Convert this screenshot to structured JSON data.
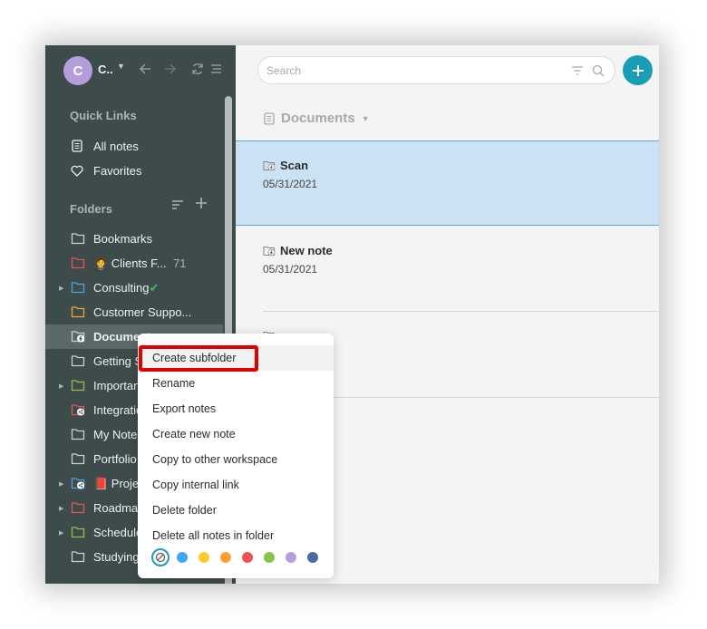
{
  "workspace": {
    "initial": "C",
    "name": "C..",
    "avatar_color": "#b39ddb"
  },
  "toolbar_icons": [
    "chevron-down-icon",
    "back-arrow-icon",
    "forward-arrow-icon",
    "sync-icon",
    "menu-icon"
  ],
  "quick_links": {
    "title": "Quick Links",
    "items": [
      {
        "label": "All notes",
        "icon": "note-icon"
      },
      {
        "label": "Favorites",
        "icon": "heart-icon"
      }
    ]
  },
  "folders": {
    "title": "Folders",
    "items": [
      {
        "label": "Bookmarks",
        "color": "#c8d0d0",
        "expandable": false
      },
      {
        "label": "Clients F...",
        "emoji": "🤵",
        "count": "71",
        "color": "#e8515a",
        "expandable": false
      },
      {
        "label": "Consulting",
        "suffix": "✔",
        "color": "#4aa3e8",
        "expandable": true
      },
      {
        "label": "Customer Suppo...",
        "color": "#f2a33a",
        "expandable": false
      },
      {
        "label": "Documents",
        "color": "#c8d0d0",
        "expandable": false,
        "active": true,
        "badge": "lightning"
      },
      {
        "label": "Getting Started",
        "color": "#c8d0d0",
        "expandable": false
      },
      {
        "label": "Important",
        "color": "#8bc34a",
        "expandable": true
      },
      {
        "label": "Integrations",
        "color": "#e8515a",
        "expandable": false,
        "badge": "share"
      },
      {
        "label": "My Notes",
        "color": "#c8d0d0",
        "expandable": false
      },
      {
        "label": "Portfolio",
        "color": "#c8d0d0",
        "expandable": false
      },
      {
        "label": "Projects",
        "emoji": "📕",
        "color": "#4aa3e8",
        "expandable": true,
        "badge": "share"
      },
      {
        "label": "Roadmap",
        "color": "#e8515a",
        "expandable": true
      },
      {
        "label": "Schedule",
        "color": "#8bc34a",
        "expandable": true
      },
      {
        "label": "Studying",
        "color": "#c8d0d0",
        "expandable": false
      }
    ]
  },
  "search": {
    "placeholder": "Search",
    "value": ""
  },
  "list": {
    "title": "Documents",
    "notes": [
      {
        "title": "Scan",
        "date": "05/31/2021",
        "selected": true
      },
      {
        "title": "New note",
        "date": "05/31/2021",
        "selected": false
      },
      {
        "title": "",
        "date": "",
        "selected": false
      }
    ]
  },
  "context_menu": {
    "items": [
      "Create subfolder",
      "Rename",
      "Export notes",
      "Create new note",
      "Copy to other workspace",
      "Copy internal link",
      "Delete folder",
      "Delete all notes in folder"
    ],
    "highlighted": "Create subfolder",
    "colors": [
      "#42a5f5",
      "#ffca28",
      "#ffa033",
      "#ef5350",
      "#8bc34a",
      "#b39ddb",
      "#4e6aa0"
    ]
  },
  "accent_color": "#1a9eb5"
}
